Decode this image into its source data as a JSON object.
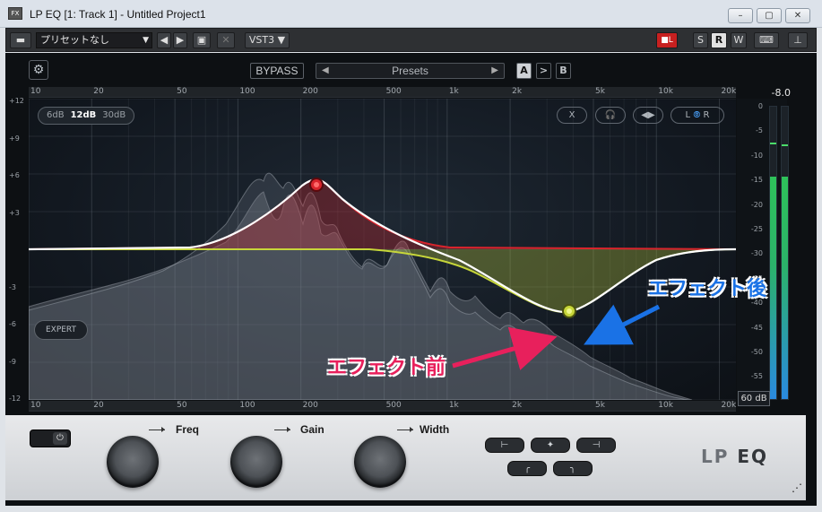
{
  "window": {
    "title": "LP EQ [1: Track 1] - Untitled Project1",
    "minimize": "–",
    "restore": "▢",
    "close": "✕"
  },
  "toolbar": {
    "preset_name": "プリセットなし",
    "format": "VST3",
    "read": "R",
    "write": "W",
    "s_label": "S"
  },
  "plugin": {
    "bypass": "BYPASS",
    "presets": "Presets",
    "a": "A",
    "copy": ">",
    "b": "B",
    "range_options": [
      "6dB",
      "12dB",
      "30dB"
    ],
    "range_selected": "12dB",
    "monitor": {
      "x": "X",
      "l": "L",
      "r": "R"
    },
    "expert": "EXPERT",
    "freq_ticks": [
      "10",
      "20",
      "50",
      "100",
      "200",
      "500",
      "1k",
      "2k",
      "5k",
      "10k",
      "20k"
    ],
    "db_ticks": [
      "+12",
      "+9",
      "+6",
      "+3",
      "",
      "-3",
      "-6",
      "-9",
      "-12"
    ],
    "peak_value": "-8.0",
    "meter_ticks": [
      "0",
      "-5",
      "-10",
      "-15",
      "-20",
      "-25",
      "-30",
      "-35",
      "-40",
      "-45",
      "-50",
      "-55",
      "-60"
    ],
    "meter_range": "60 dB",
    "meter_level": 0.76,
    "knobs": {
      "freq": "Freq",
      "gain": "Gain",
      "width": "Width"
    },
    "logo_a": "LP",
    "logo_b": "EQ"
  },
  "annotations": {
    "after": "エフェクト後",
    "before": "エフェクト前"
  },
  "colors": {
    "band1": "#d9242c",
    "band2": "#c7d63a",
    "curve": "#ffffff",
    "meter_green": "#2ec25a",
    "meter_blue": "#2a8ae0",
    "arrow_after": "#1a72e6",
    "arrow_before": "#e8205c"
  }
}
